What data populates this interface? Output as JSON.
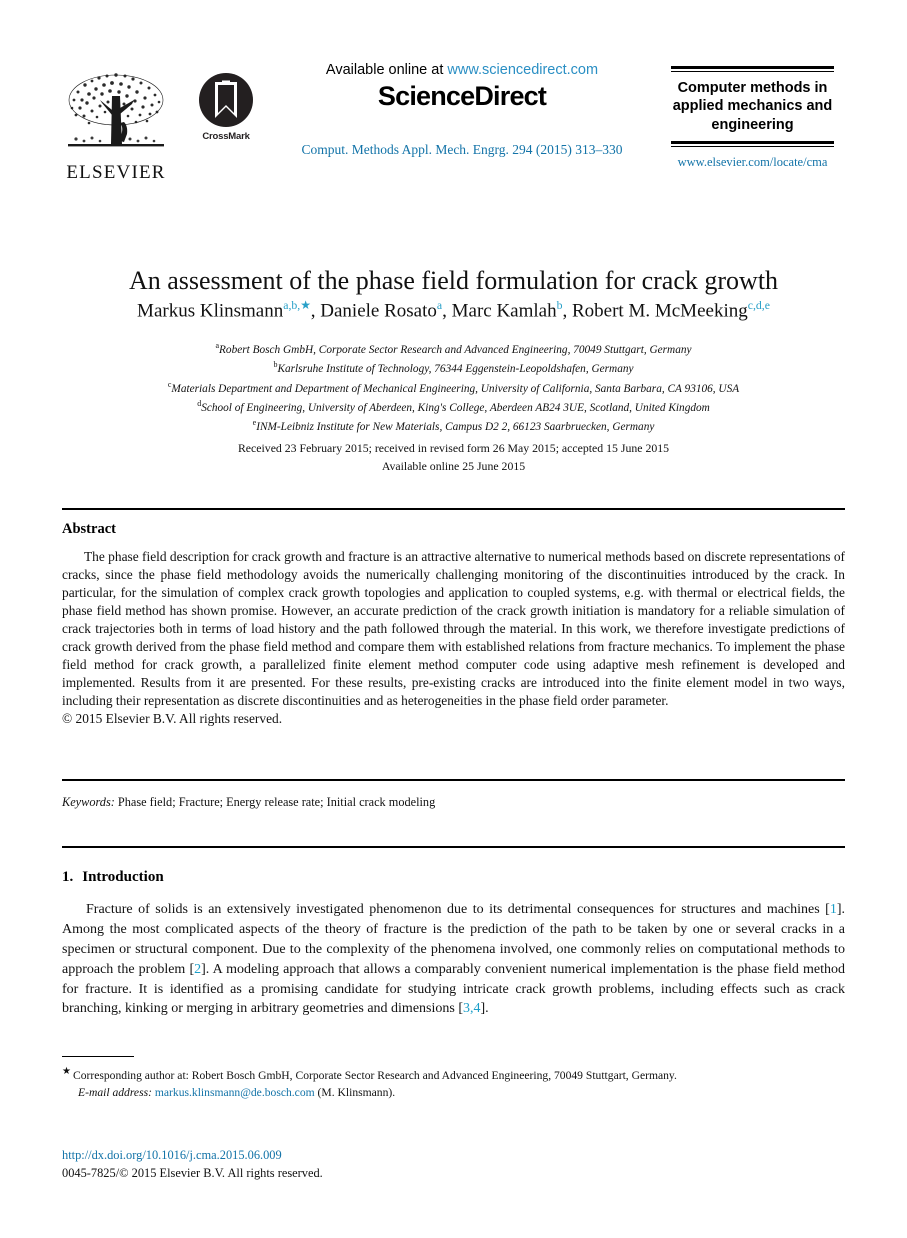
{
  "masthead": {
    "publisher_logo_text": "ELSEVIER",
    "crossmark_label": "CrossMark",
    "available_prefix": "Available online at ",
    "available_url": "www.sciencedirect.com",
    "wordmark": "ScienceDirect",
    "journal_reference": "Comput. Methods Appl. Mech. Engrg. 294 (2015) 313–330",
    "journal_title": "Computer methods in applied mechanics and engineering",
    "journal_homepage": "www.elsevier.com/locate/cma",
    "link_color": "#1273a8",
    "accent_color": "#28a0c8"
  },
  "article": {
    "title": "An assessment of the phase field formulation for crack growth",
    "authors": [
      {
        "name": "Markus Klinsmann",
        "marks": "a,b,★",
        "separator": ", "
      },
      {
        "name": "Daniele Rosato",
        "marks": "a",
        "separator": ", "
      },
      {
        "name": "Marc Kamlah",
        "marks": "b",
        "separator": ", "
      },
      {
        "name": "Robert M. McMeeking",
        "marks": "c,d,e",
        "separator": ""
      }
    ],
    "affiliations": [
      {
        "label": "a",
        "text": "Robert Bosch GmbH, Corporate Sector Research and Advanced Engineering, 70049 Stuttgart, Germany"
      },
      {
        "label": "b",
        "text": "Karlsruhe Institute of Technology, 76344 Eggenstein-Leopoldshafen, Germany"
      },
      {
        "label": "c",
        "text": "Materials Department and Department of Mechanical Engineering, University of California, Santa Barbara, CA 93106, USA"
      },
      {
        "label": "d",
        "text": "School of Engineering, University of Aberdeen, King's College, Aberdeen AB24 3UE, Scotland, United Kingdom"
      },
      {
        "label": "e",
        "text": "INM-Leibniz Institute for New Materials, Campus D2 2, 66123 Saarbruecken, Germany"
      }
    ],
    "dates_line1": "Received 23 February 2015; received in revised form 26 May 2015; accepted 15 June 2015",
    "dates_line2": "Available online 25 June 2015"
  },
  "abstract": {
    "heading": "Abstract",
    "body": "The phase field description for crack growth and fracture is an attractive alternative to numerical methods based on discrete representations of cracks, since the phase field methodology avoids the numerically challenging monitoring of the discontinuities introduced by the crack. In particular, for the simulation of complex crack growth topologies and application to coupled systems, e.g. with thermal or electrical fields, the phase field method has shown promise. However, an accurate prediction of the crack growth initiation is mandatory for a reliable simulation of crack trajectories both in terms of load history and the path followed through the material. In this work, we therefore investigate predictions of crack growth derived from the phase field method and compare them with established relations from fracture mechanics. To implement the phase field method for crack growth, a parallelized finite element method computer code using adaptive mesh refinement is developed and implemented. Results from it are presented. For these results, pre-existing cracks are introduced into the finite element model in two ways, including their representation as discrete discontinuities and as heterogeneities in the phase field order parameter.",
    "copyright": "© 2015 Elsevier B.V. All rights reserved."
  },
  "keywords": {
    "label": "Keywords:",
    "text": "Phase field; Fracture; Energy release rate; Initial crack modeling"
  },
  "section": {
    "number": "1.",
    "heading": "Introduction",
    "paragraph_parts": [
      {
        "type": "text",
        "value": "Fracture of solids is an extensively investigated phenomenon due to its detrimental consequences for structures and machines ["
      },
      {
        "type": "cite",
        "value": "1"
      },
      {
        "type": "text",
        "value": "]. Among the most complicated aspects of the theory of fracture is the prediction of the path to be taken by one or several cracks in a specimen or structural component. Due to the complexity of the phenomena involved, one commonly relies on computational methods to approach the problem ["
      },
      {
        "type": "cite",
        "value": "2"
      },
      {
        "type": "text",
        "value": "]. A modeling approach that allows a comparably convenient numerical implementation is the phase field method for fracture. It is identified as a promising candidate for studying intricate crack growth problems, including effects such as crack branching, kinking or merging in arbitrary geometries and dimensions ["
      },
      {
        "type": "cite",
        "value": "3,4"
      },
      {
        "type": "text",
        "value": "]."
      }
    ]
  },
  "footnotes": {
    "corresponding_star": "★",
    "corresponding": "Corresponding author at: Robert Bosch GmbH, Corporate Sector Research and Advanced Engineering, 70049 Stuttgart, Germany.",
    "email_label": "E-mail address:",
    "email": "markus.klinsmann@de.bosch.com",
    "email_suffix": "(M. Klinsmann)."
  },
  "publication_footer": {
    "doi": "http://dx.doi.org/10.1016/j.cma.2015.06.009",
    "issn_line": "0045-7825/© 2015 Elsevier B.V. All rights reserved."
  }
}
